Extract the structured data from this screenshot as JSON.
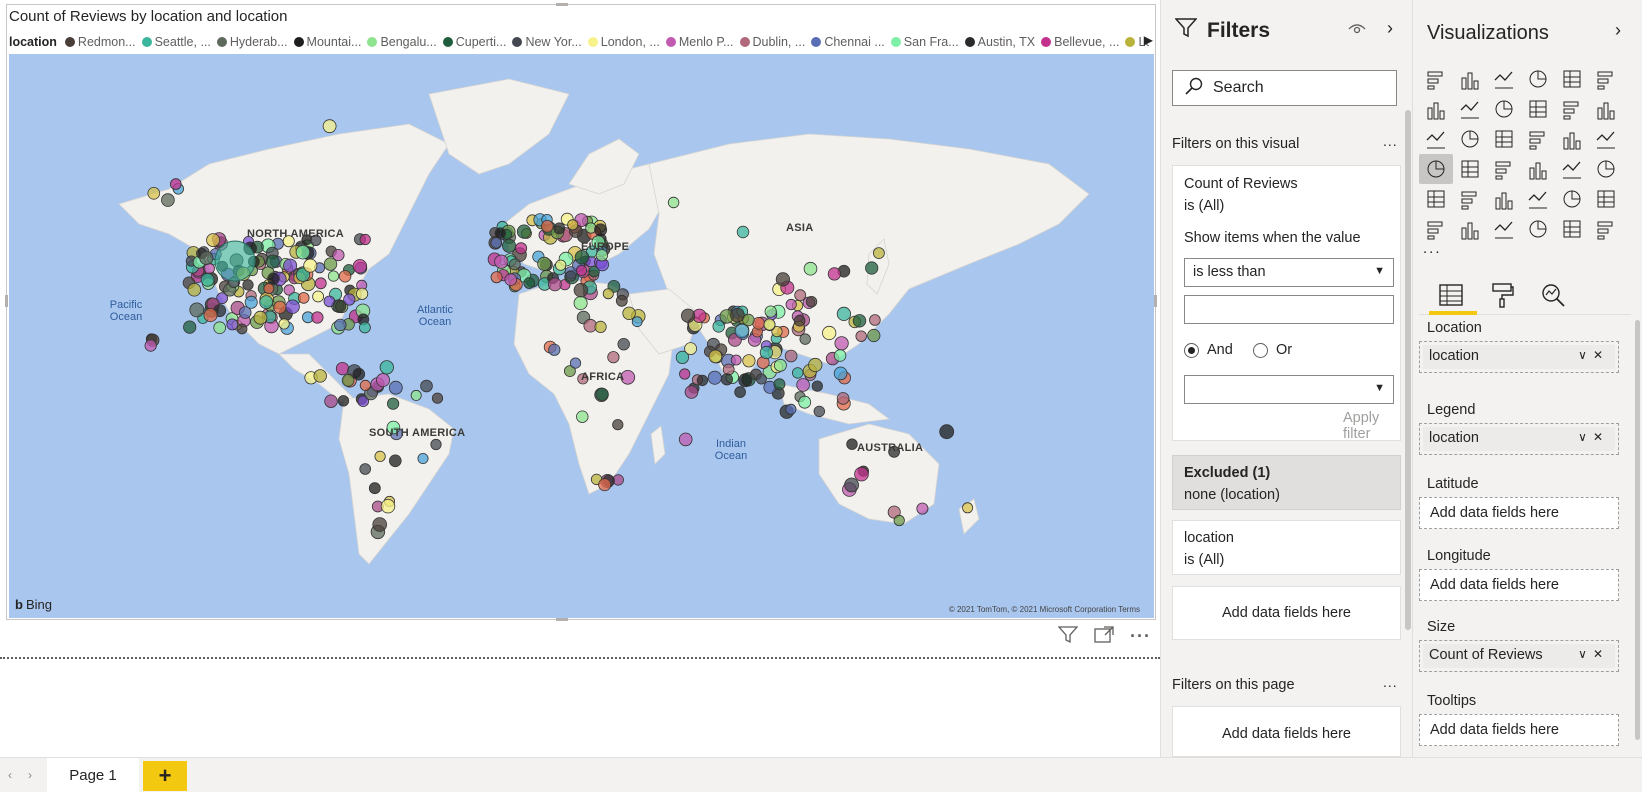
{
  "visual": {
    "title": "Count of Reviews by location and location",
    "legend_title": "location",
    "legend": [
      {
        "label": "Redmon...",
        "color": "#4a3f38"
      },
      {
        "label": "Seattle, ...",
        "color": "#3bb59c"
      },
      {
        "label": "Hyderab...",
        "color": "#5d6a5c"
      },
      {
        "label": "Mountai...",
        "color": "#1e1e1e"
      },
      {
        "label": "Bengalu...",
        "color": "#8fe48f"
      },
      {
        "label": "Cuperti...",
        "color": "#1f5e3c"
      },
      {
        "label": "New Yor...",
        "color": "#444850"
      },
      {
        "label": "London, ...",
        "color": "#f7f28a"
      },
      {
        "label": "Menlo P...",
        "color": "#c15bb2"
      },
      {
        "label": "Dublin, ...",
        "color": "#b0687a"
      },
      {
        "label": "Chennai ...",
        "color": "#5a6fb3"
      },
      {
        "label": "San Fra...",
        "color": "#7ef0a6"
      },
      {
        "label": "Austin, TX",
        "color": "#2b2b2b"
      },
      {
        "label": "Bellevue, ...",
        "color": "#c3318d"
      },
      {
        "label": "Los Ang...",
        "color": "#b9b33c"
      }
    ],
    "map_labels": {
      "north_america": "NORTH AMERICA",
      "south_america": "SOUTH AMERICA",
      "europe": "EUROPE",
      "africa": "AFRICA",
      "asia": "ASIA",
      "australia": "AUSTRALIA",
      "pacific": "Pacific Ocean",
      "atlantic": "Atlantic Ocean",
      "indian": "Indian Ocean"
    },
    "bing_label": "Bing",
    "copyright": "© 2021 TomTom, © 2021 Microsoft Corporation  Terms"
  },
  "tabs": {
    "page_label": "Page 1",
    "add_label": "+"
  },
  "filters": {
    "title": "Filters",
    "search_placeholder": "Search",
    "on_visual_label": "Filters on this visual",
    "more": "...",
    "card1": {
      "title": "Count of Reviews",
      "subtitle": "is (All)",
      "show_items": "Show items when the value",
      "condition": "is less than",
      "and_label": "And",
      "or_label": "Or",
      "apply": "Apply filter"
    },
    "excluded": {
      "title": "Excluded (1)",
      "subtitle": "none (location)"
    },
    "card3": {
      "title": "location",
      "subtitle": "is (All)"
    },
    "add_fields": "Add data fields here",
    "on_page_label": "Filters on this page"
  },
  "viz": {
    "title": "Visualizations",
    "more": "...",
    "wells": [
      {
        "label": "Location",
        "value": "location"
      },
      {
        "label": "Legend",
        "value": "location"
      },
      {
        "label": "Latitude",
        "value": ""
      },
      {
        "label": "Longitude",
        "value": ""
      },
      {
        "label": "Size",
        "value": "Count of Reviews"
      },
      {
        "label": "Tooltips",
        "value": ""
      }
    ],
    "add_fields": "Add data fields here"
  },
  "colors": {
    "accent": "#f2c811",
    "ocean": "#a9c6ef",
    "land": "#f2f1ee"
  }
}
